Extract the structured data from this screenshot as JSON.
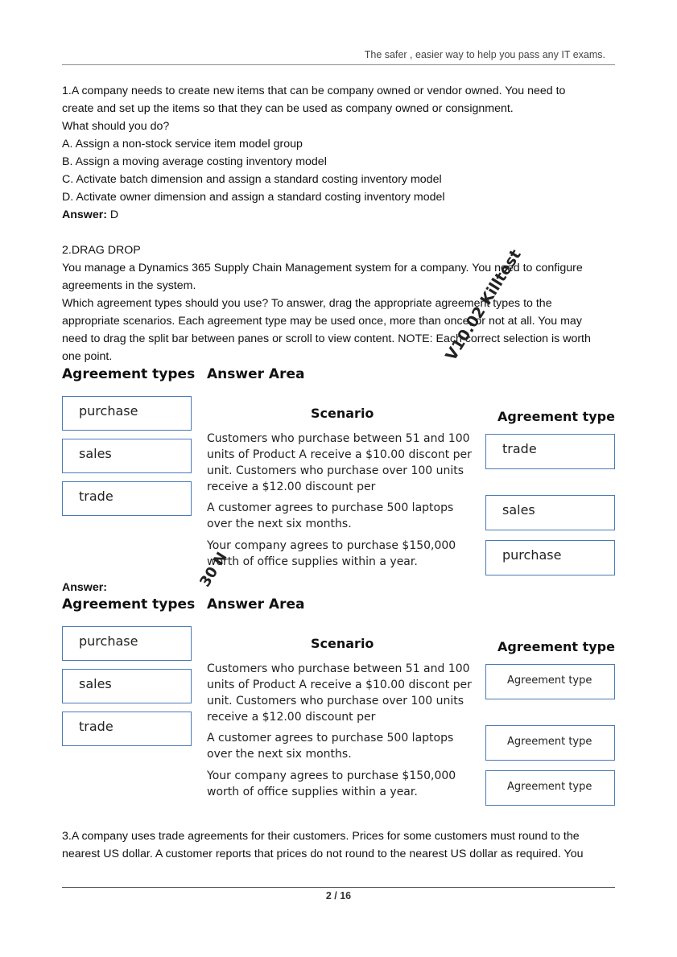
{
  "header": "The safer , easier way to help you pass any IT exams.",
  "q1": {
    "lines": [
      "1.A company needs to create new items that can be company owned or vendor owned. You need to",
      "create and set up the items so that they can be used as company owned or consignment.",
      "What should you do?",
      "A. Assign a non-stock service item model group",
      "B. Assign a moving average costing inventory model",
      "C. Activate batch dimension and assign a standard costing inventory model",
      "D. Activate owner dimension and assign a standard costing inventory model"
    ],
    "answer_label": "Answer:",
    "answer": " D"
  },
  "q2": {
    "lines": [
      "2.DRAG DROP",
      "You manage a Dynamics 365 Supply Chain Management system for a company. You need to configure",
      "agreements in the system.",
      "Which agreement types should you use? To answer, drag the appropriate agreement types to the",
      "appropriate scenarios. Each agreement type may be used once, more than once, or not at all. You may",
      "need to drag the split bar between panes or scroll to view content. NOTE: Each correct selection is worth",
      "one point."
    ],
    "answer_label": "Answer:"
  },
  "figure": {
    "types_heading": "Agreement types",
    "answer_area": "Answer Area",
    "scenario_heading": "Scenario",
    "type_heading": "Agreement type",
    "types": [
      "purchase",
      "sales",
      "trade"
    ],
    "scenarios": [
      [
        "Customers who purchase between 51 and 100",
        "units of Product A receive a $10.00 discont per",
        "unit. Customers who purchase over 100 units",
        "receive a $12.00 discount per"
      ],
      [
        "A customer agrees to purchase 500 laptops",
        "over the next six months."
      ],
      [
        "Your company agrees to purchase $150,000",
        "worth of office supplies within  a year."
      ]
    ],
    "q_answers": [
      "trade",
      "sales",
      "purchase"
    ],
    "a_answers": [
      "Agreement type",
      "Agreement type",
      "Agreement type"
    ]
  },
  "q3": {
    "lines": [
      "3.A company uses trade agreements for their customers. Prices for some customers must round to the",
      "nearest US dollar. A customer reports that prices do not round to the nearest US dollar as required. You"
    ]
  },
  "watermark": [
    "V10.02 Killtest",
    "30 N"
  ],
  "footer": "2  /  16"
}
